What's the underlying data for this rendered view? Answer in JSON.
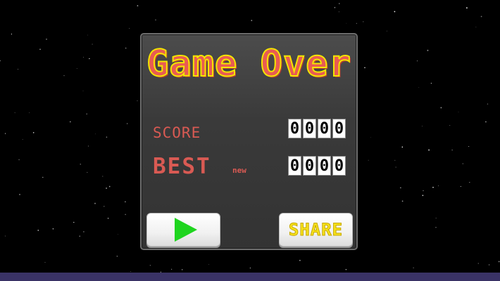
{
  "game": {
    "title": "Game Over",
    "score_label": "SCORE",
    "best_label": "BEST",
    "new_label": "new",
    "score_digits": [
      "0",
      "0",
      "0",
      "0"
    ],
    "best_digits": [
      "0",
      "0",
      "0",
      "0"
    ],
    "play_icon": "play-icon",
    "share_label": "SHARE"
  },
  "colors": {
    "background": "#000000",
    "panel": "#3f3f3f",
    "title_fill": "#e95b53",
    "title_outline": "#f3e600",
    "label": "#d95a53",
    "play_icon": "#1fd51f",
    "share_text": "#f7e21c",
    "bottom_bar": "#3a3366"
  }
}
